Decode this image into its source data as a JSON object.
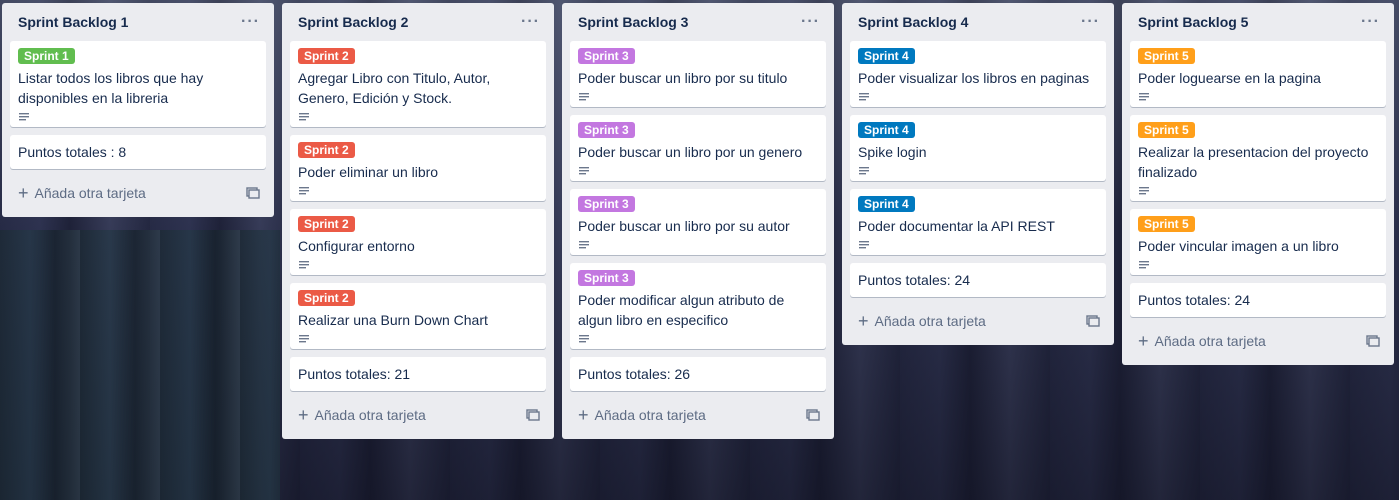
{
  "colors": {
    "sprint1": "#61bd4f",
    "sprint2": "#eb5a46",
    "sprint3": "#c377e0",
    "sprint4": "#0079bf",
    "sprint5": "#ff9f1a"
  },
  "lists": [
    {
      "title": "Sprint Backlog 1",
      "cards": [
        {
          "label": "Sprint 1",
          "title": "Listar todos los libros que hay disponibles en la libreria"
        }
      ],
      "total": "Puntos totales : 8",
      "add": "Añada otra tarjeta"
    },
    {
      "title": "Sprint Backlog 2",
      "cards": [
        {
          "label": "Sprint 2",
          "title": "Agregar Libro con Titulo, Autor, Genero, Edición y Stock."
        },
        {
          "label": "Sprint 2",
          "title": "Poder eliminar un libro"
        },
        {
          "label": "Sprint 2",
          "title": "Configurar entorno"
        },
        {
          "label": "Sprint 2",
          "title": "Realizar una Burn Down Chart"
        }
      ],
      "total": "Puntos totales: 21",
      "add": "Añada otra tarjeta"
    },
    {
      "title": "Sprint Backlog 3",
      "cards": [
        {
          "label": "Sprint 3",
          "title": "Poder buscar un libro por su titulo"
        },
        {
          "label": "Sprint 3",
          "title": "Poder buscar un libro por un genero"
        },
        {
          "label": "Sprint 3",
          "title": "Poder buscar un libro por su autor"
        },
        {
          "label": "Sprint 3",
          "title": "Poder modificar algun atributo de algun libro en especifico"
        }
      ],
      "total": "Puntos totales: 26",
      "add": "Añada otra tarjeta"
    },
    {
      "title": "Sprint Backlog 4",
      "cards": [
        {
          "label": "Sprint 4",
          "title": "Poder visualizar los libros en paginas"
        },
        {
          "label": "Sprint 4",
          "title": "Spike login"
        },
        {
          "label": "Sprint 4",
          "title": "Poder documentar la API REST"
        }
      ],
      "total": "Puntos totales: 24",
      "add": "Añada otra tarjeta"
    },
    {
      "title": "Sprint Backlog 5",
      "cards": [
        {
          "label": "Sprint 5",
          "title": "Poder loguearse en la pagina"
        },
        {
          "label": "Sprint 5",
          "title": "Realizar la presentacion del proyecto finalizado"
        },
        {
          "label": "Sprint 5",
          "title": "Poder vincular imagen a un libro"
        }
      ],
      "total": "Puntos totales: 24",
      "add": "Añada otra tarjeta"
    }
  ],
  "icons": {
    "menu": "more-horizontal-icon",
    "description": "description-icon",
    "add": "plus-icon",
    "template": "card-template-icon"
  }
}
